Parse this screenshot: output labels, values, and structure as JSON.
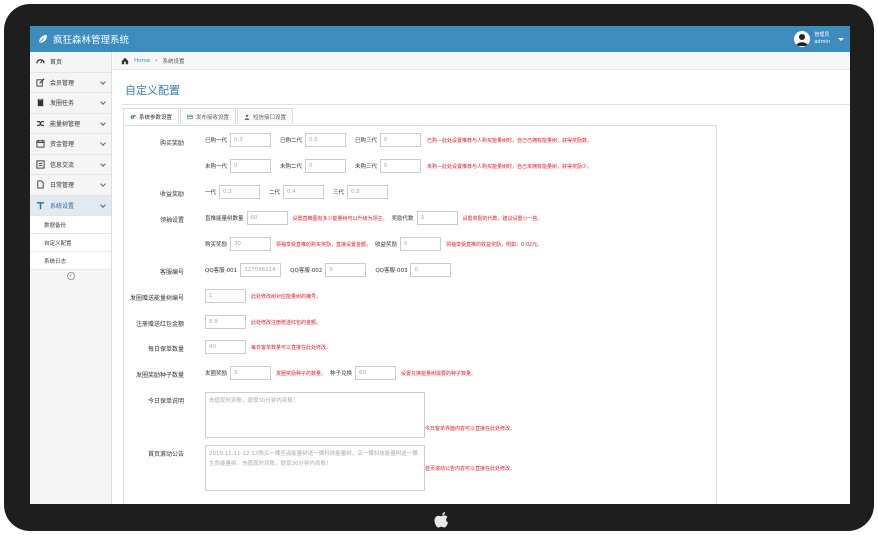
{
  "app": {
    "title": "疯狂森林管理系统"
  },
  "user": {
    "name": "管理员",
    "account": "admin"
  },
  "breadcrumb": {
    "home": "Home",
    "sep": "›",
    "current": "系统设置"
  },
  "sidebar": {
    "items": [
      {
        "label": "首页"
      },
      {
        "label": "会员管理"
      },
      {
        "label": "发圈任务"
      },
      {
        "label": "能量树管理"
      },
      {
        "label": "资金管理"
      },
      {
        "label": "信息交流"
      },
      {
        "label": "日常管理"
      },
      {
        "label": "系统设置"
      }
    ],
    "subitems": [
      {
        "label": "数据备份"
      },
      {
        "label": "自定义配置"
      },
      {
        "label": "系统日志"
      }
    ],
    "collapse": "«"
  },
  "page": {
    "title": "自定义配置"
  },
  "tabs": [
    {
      "label": "系统参数设置"
    },
    {
      "label": "发布接收设置"
    },
    {
      "label": "短信接口设置"
    }
  ],
  "form": {
    "buy": {
      "label": "购买奖励",
      "l1": "已购一代",
      "v1": "0.3",
      "l2": "已购二代",
      "v2": "0.5",
      "l3": "已购三代",
      "v3": "0",
      "note1": "已购—此处设置推荐与人购买能量树时，自己已拥有能量树，获得奖励数。",
      "l4": "未购一代",
      "v4": "0",
      "l5": "未购二代",
      "v5": "0",
      "l6": "未购三代",
      "v6": "0",
      "note2": "未购—此处设置推荐与人购买能量树时，自己未拥有能量树，获得奖励少。"
    },
    "income": {
      "label": "收益奖励",
      "l1": "一代",
      "v1": "0.3",
      "l2": "二代",
      "v2": "0.4",
      "l3": "三代",
      "v3": "0.8"
    },
    "lead": {
      "label": "领袖设置",
      "l1": "直推能量树数量",
      "v1": "60",
      "note1": "设置直推图有多少能量树可以升级为领主。",
      "l2": "奖励代数",
      "v2": "3",
      "note2": "设置奖励的代数，建议设置小一些。",
      "l3": "购买奖励",
      "v3": "30",
      "note3": "领袖享受直推的购买奖励，直接设置金额。",
      "l4": "收益奖励",
      "v4": "5",
      "note4": "领袖享受直推的收益奖励，例如：0.02元。"
    },
    "qq": {
      "label": "客服编号",
      "l1": "QQ客服-001",
      "v1": "327036214",
      "l2": "QQ客服-002",
      "v2": "0",
      "l3": "QQ客服-003",
      "v3": "0"
    },
    "circleTreeNo": {
      "label": "发圈赠送能量树编号",
      "value": "1",
      "note": "此处修改树对应能量树的编号。"
    },
    "redpacket": {
      "label": "注册赠送红包金额",
      "value": "8.8",
      "note": "此处修改注册赠送红包的金额。"
    },
    "dailyDeals": {
      "label": "每日保单数量",
      "value": "40",
      "note": "每日客单数量可以直接在此处修改。"
    },
    "circleSeeds": {
      "label": "发圈奖励种子数量",
      "l1": "发圈奖励",
      "v1": "5",
      "note1": "发圈奖励种子的数量。",
      "l2": "种子兑换",
      "v2": "60",
      "note2": "设置兑换能量树需要的种子数量。"
    },
    "todayNote": {
      "label": "今日保单说明",
      "placeholder": "充值现时到账，提现30分钟内到账！",
      "note": "今日客单界面内容可以直接在此处修改。"
    },
    "announce": {
      "label": "首页滚动公告",
      "text": "2019.11.11-12.12购买一棵圣诞能量树送一棵科技能量树，买一棵科技能量树送一棵生命能量树。充值现时到账，提现30分钟内到账！",
      "note": "首页滚动公告内容可以直接在此处修改。"
    }
  }
}
